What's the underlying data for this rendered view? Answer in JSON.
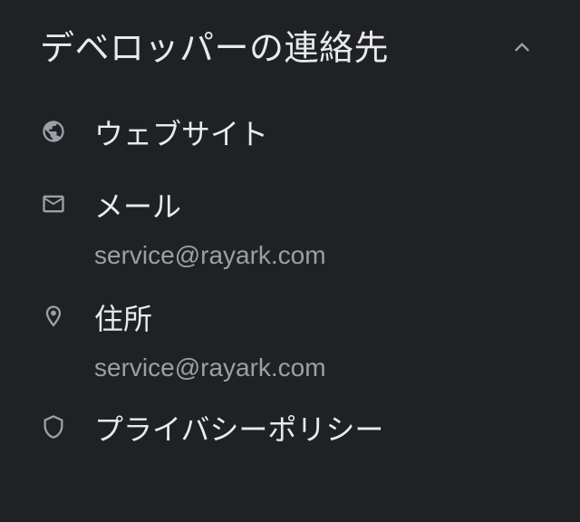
{
  "section": {
    "title": "デベロッパーの連絡先",
    "collapse_icon": "chevron-up-icon",
    "expanded": true
  },
  "colors": {
    "background": "#202124",
    "primary_text": "#e8eaed",
    "secondary_text": "#9aa0a6",
    "icon": "#9aa0a6"
  },
  "items": [
    {
      "icon": "globe-icon",
      "label": "ウェブサイト"
    },
    {
      "icon": "mail-icon",
      "label": "メール",
      "value": "service@rayark.com"
    },
    {
      "icon": "location-pin-icon",
      "label": "住所",
      "value": "service@rayark.com"
    },
    {
      "icon": "shield-icon",
      "label": "プライバシーポリシー"
    }
  ]
}
